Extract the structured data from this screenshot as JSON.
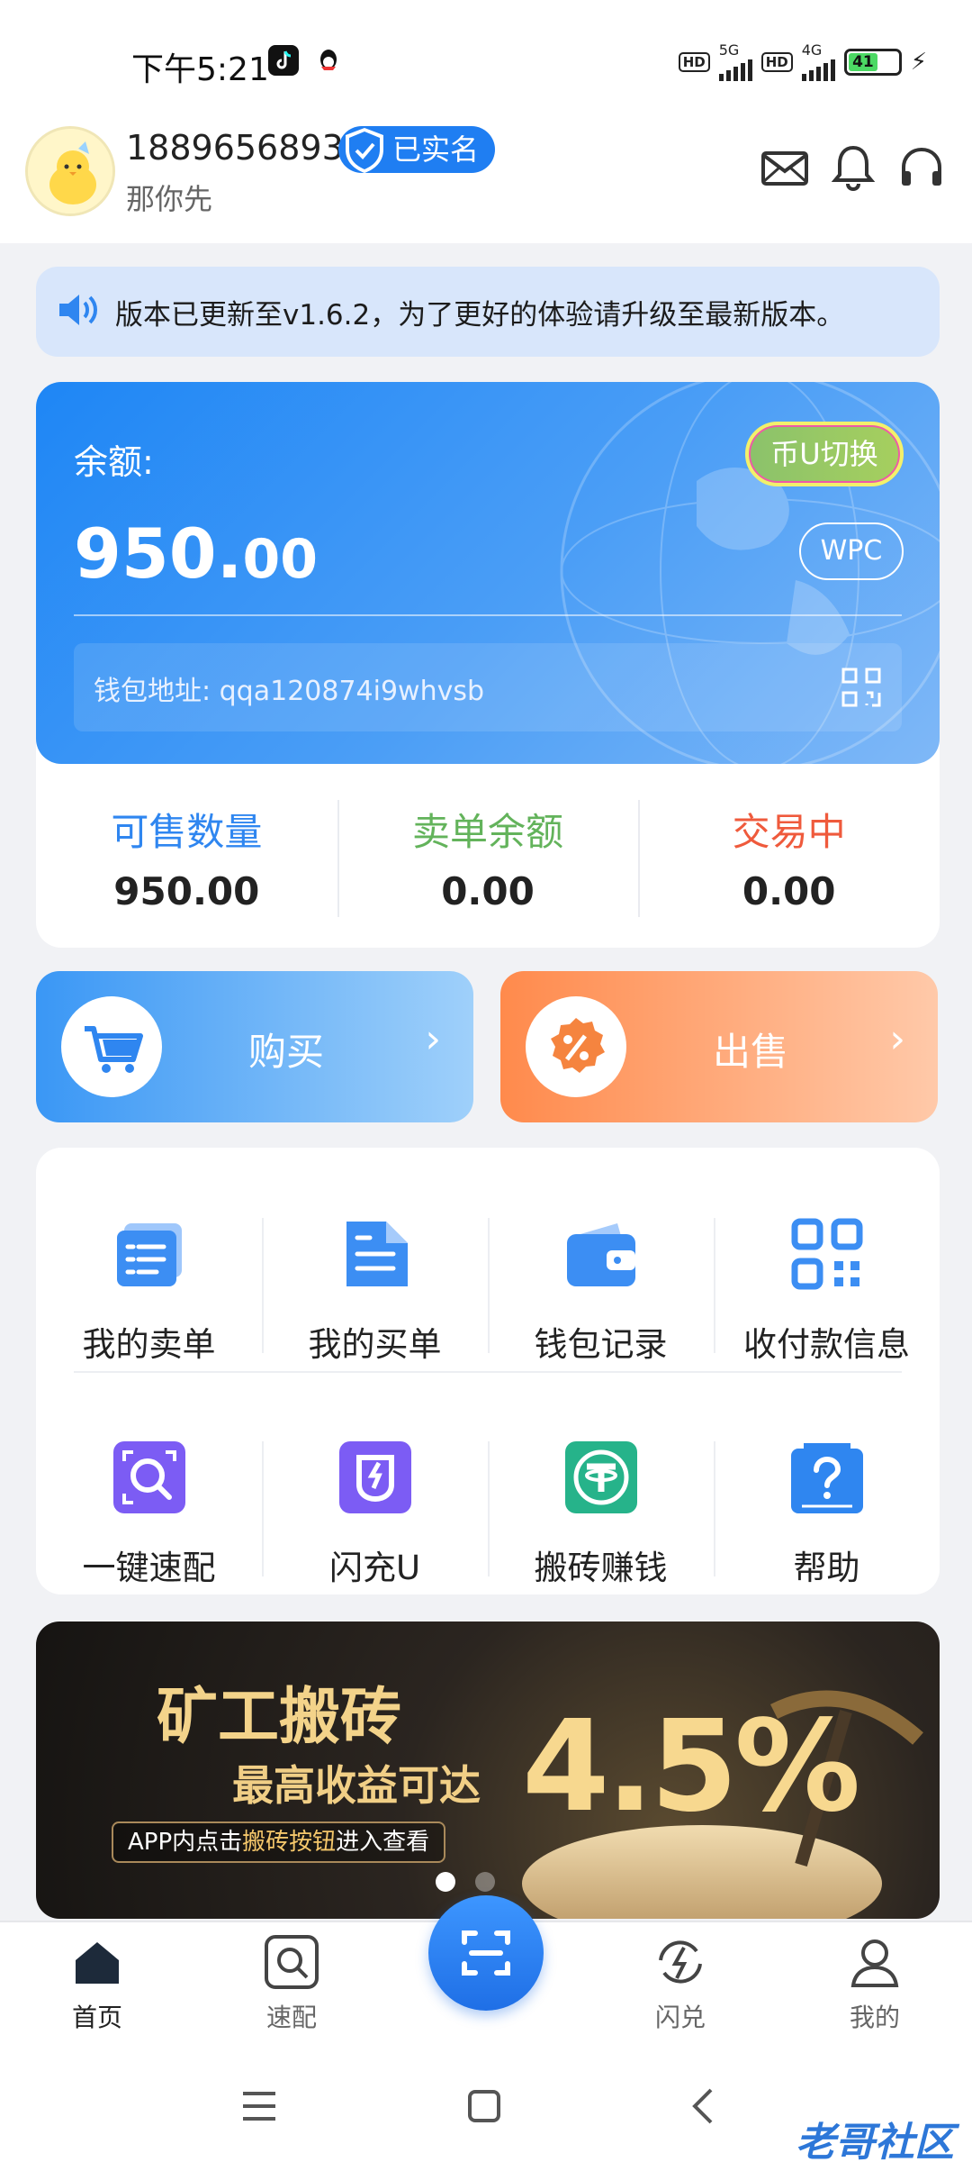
{
  "status_bar": {
    "time": "下午5:21",
    "net1": "5G",
    "net2": "4G",
    "hd": "HD",
    "battery": "41"
  },
  "profile": {
    "phone": "18896568938",
    "verified_label": "已实名",
    "nickname": "那你先"
  },
  "notice": {
    "text": "版本已更新至v1.6.2，为了更好的体验请升级至最新版本。"
  },
  "balance": {
    "label": "余额:",
    "amount_int": "950.",
    "amount_dec": "00",
    "switch_label": "币U切换",
    "currency": "WPC",
    "wallet_address": "钱包地址:  qqa120874i9whvsb"
  },
  "stats": [
    {
      "label": "可售数量",
      "value": "950.00",
      "color": "#2f86f0"
    },
    {
      "label": "卖单余额",
      "value": "0.00",
      "color": "#63b35b"
    },
    {
      "label": "交易中",
      "value": "0.00",
      "color": "#ef5a3c"
    }
  ],
  "actions": {
    "buy": "购买",
    "sell": "出售"
  },
  "menu": [
    {
      "label": "我的卖单",
      "icon": "sell-orders-icon"
    },
    {
      "label": "我的买单",
      "icon": "buy-orders-icon"
    },
    {
      "label": "钱包记录",
      "icon": "wallet-icon"
    },
    {
      "label": "收付款信息",
      "icon": "payment-qr-icon"
    },
    {
      "label": "一键速配",
      "icon": "quick-match-icon"
    },
    {
      "label": "闪充U",
      "icon": "flash-charge-icon"
    },
    {
      "label": "搬砖赚钱",
      "icon": "tether-icon"
    },
    {
      "label": "帮助",
      "icon": "help-icon"
    }
  ],
  "banner": {
    "title": "矿工搬砖",
    "subtitle": "最高收益可达",
    "percent": "4.5%",
    "pill_prefix": "APP内点击",
    "pill_highlight": "搬砖按钮",
    "pill_suffix": "进入查看"
  },
  "bottom_nav": [
    {
      "label": "首页",
      "icon": "home-icon",
      "active": true
    },
    {
      "label": "速配",
      "icon": "match-icon",
      "active": false
    },
    {
      "label": "闪兑",
      "icon": "flash-exchange-icon",
      "active": false
    },
    {
      "label": "我的",
      "icon": "profile-icon",
      "active": false
    }
  ],
  "watermark": "老哥社区",
  "colors": {
    "primary": "#1f7ef2",
    "sell_orange": "#ff8a4c",
    "buy_blue": "#3a97f5"
  }
}
